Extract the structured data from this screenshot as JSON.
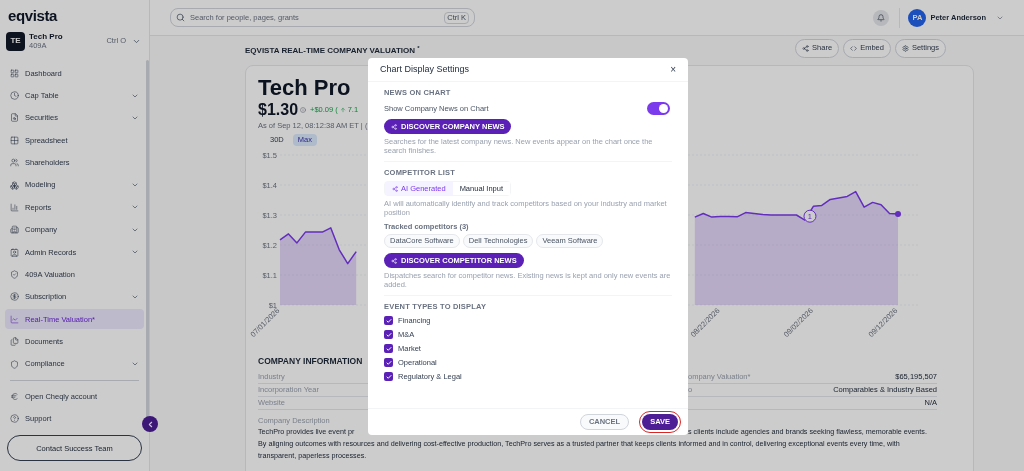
{
  "sidebar": {
    "logo": "eqvista",
    "workspace": {
      "initials": "TE",
      "name": "Tech Pro",
      "subtitle": "409A",
      "shortcut": "Ctrl O"
    },
    "items": [
      {
        "label": "Dashboard",
        "expandable": false,
        "selected": false
      },
      {
        "label": "Cap Table",
        "expandable": true,
        "selected": false
      },
      {
        "label": "Securities",
        "expandable": true,
        "selected": false
      },
      {
        "label": "Spreadsheet",
        "expandable": false,
        "selected": false
      },
      {
        "label": "Shareholders",
        "expandable": false,
        "selected": false
      },
      {
        "label": "Modeling",
        "expandable": true,
        "selected": false
      },
      {
        "label": "Reports",
        "expandable": true,
        "selected": false
      },
      {
        "label": "Company",
        "expandable": true,
        "selected": false
      },
      {
        "label": "Admin Records",
        "expandable": true,
        "selected": false
      },
      {
        "label": "409A Valuation",
        "expandable": false,
        "selected": false
      },
      {
        "label": "Subscription",
        "expandable": true,
        "selected": false
      },
      {
        "label": "Real-Time Valuation*",
        "expandable": false,
        "selected": true
      },
      {
        "label": "Documents",
        "expandable": false,
        "selected": false
      },
      {
        "label": "Compliance",
        "expandable": true,
        "selected": false
      }
    ],
    "footer_items": [
      {
        "label": "Open Cheqly account"
      },
      {
        "label": "Support"
      }
    ],
    "contact_button": "Contact Success Team"
  },
  "header": {
    "search": {
      "placeholder": "Search for people, pages, grants",
      "shortcut": "Ctrl K"
    },
    "user": {
      "initials": "PA",
      "name": "Peter Anderson"
    }
  },
  "page": {
    "title": "EQVISTA REAL-TIME COMPANY VALUATION $^{*}$",
    "actions": [
      "Share",
      "Embed",
      "Settings"
    ]
  },
  "valuation_card": {
    "company": "Tech Pro",
    "price": "$1.30",
    "change": "+$0.09",
    "change_open": "(",
    "change_pct": "7.1",
    "as_of": "As of Sep 12, 08:12:38 AM ET | (",
    "ranges": [
      {
        "label": "30D",
        "selected": false
      },
      {
        "label": "Max",
        "selected": true
      }
    ],
    "chart_data": {
      "type": "area",
      "ylim": [
        1,
        1.5
      ],
      "categories": [
        "07/01/2026",
        null,
        null,
        null,
        null,
        null,
        null,
        null,
        null,
        null,
        null,
        null,
        null,
        null,
        null,
        null,
        null,
        null,
        null,
        null,
        null,
        null,
        null,
        null,
        null,
        null,
        null,
        null,
        null,
        null,
        null,
        null,
        null,
        null,
        null,
        null,
        null,
        null,
        null,
        null,
        null,
        null,
        null,
        null,
        null,
        null,
        null,
        null,
        null,
        null,
        null,
        null,
        "08/22/2026",
        null,
        null,
        null,
        null,
        null,
        null,
        null,
        null,
        null,
        null,
        "09/02/2026",
        null,
        null,
        null,
        null,
        null,
        null,
        null,
        null,
        null,
        "09/12/2026"
      ],
      "series": [
        {
          "color": "#7c3aed",
          "values": [
            1.217,
            1.237,
            1.207,
            1.243,
            1.243,
            1.243,
            1.257,
            1.184,
            1.138,
            1.178,
            null,
            null,
            null,
            null,
            null,
            null,
            null,
            null,
            null,
            null,
            null,
            null,
            null,
            null,
            null,
            null,
            null,
            null,
            null,
            null,
            null,
            null,
            null,
            null,
            null,
            null,
            null,
            null,
            null,
            null,
            null,
            null,
            null,
            null,
            null,
            null,
            null,
            null,
            null,
            1.293,
            1.305,
            1.293,
            1.295,
            1.295,
            1.294,
            1.308,
            1.305,
            1.302,
            1.3,
            1.3,
            1.3,
            1.3,
            1.283,
            1.329,
            1.332,
            1.352,
            1.357,
            1.362,
            1.378,
            1.326,
            1.342,
            1.334,
            1.305,
            1.303
          ]
        }
      ],
      "yticks": [
        {
          "value": 1,
          "label": "$1"
        },
        {
          "value": 1.1,
          "label": "$1.1"
        },
        {
          "value": 1.2,
          "label": "$1.2"
        },
        {
          "value": 1.3,
          "label": "$1.3"
        },
        {
          "value": 1.4,
          "label": "$1.4"
        },
        {
          "value": 1.5,
          "label": "$1.5"
        }
      ],
      "grid": true,
      "annotations": [
        {
          "y": 1.296,
          "text": "1"
        }
      ]
    }
  },
  "company_information": {
    "title": "COMPANY INFORMATION",
    "left_rows": [
      {
        "label": "Industry"
      },
      {
        "label": "Incorporation Year"
      },
      {
        "label": "Website"
      }
    ],
    "right_rows": [
      {
        "label": "ompany Valuation*",
        "value": "$65,195,507"
      },
      {
        "label": "o",
        "value": "Comparables & Industry Based"
      },
      {
        "value": "N/A"
      }
    ],
    "description_label": "Company Description",
    "description_first_line": {
      "left": "TechPro provides live event pr",
      "right": "s clients include agencies and brands seeking flawless, memorable events."
    },
    "description_lines": [
      "By aligning outcomes with resources and delivering cost-effective production, TechPro serves as a trusted partner that keeps clients informed and in control, delivering exceptional events every time, with",
      "transparent, paperless processes."
    ]
  },
  "modal": {
    "title": "Chart Display Settings",
    "close": "×",
    "news_heading": "NEWS ON CHART",
    "news_toggle": {
      "label": "Show Company News on Chart",
      "on": true
    },
    "discover_company_button": "DISCOVER COMPANY NEWS",
    "company_help": "Searches for the latest company news. New events appear on the chart once the search finishes.",
    "competitor_heading": "COMPETITOR LIST",
    "competitor_modes": [
      {
        "label": "AI Generated",
        "selected": true
      },
      {
        "label": "Manual Input",
        "selected": false
      }
    ],
    "competitor_help": "AI will automatically identify and track competitors based on your industry and market position",
    "tracked_label": "Tracked competitors (3)",
    "competitors": [
      "DataCore Software",
      "Dell Technologies",
      "Veeam Software"
    ],
    "discover_competitor_button": "DISCOVER COMPETITOR NEWS",
    "competitor_news_help": "Dispatches search for competitor news. Existing news is kept and only new events are added.",
    "event_heading": "EVENT TYPES TO DISPLAY",
    "event_types": [
      {
        "label": "Financing",
        "checked": true
      },
      {
        "label": "M&A",
        "checked": true
      },
      {
        "label": "Market",
        "checked": true
      },
      {
        "label": "Operational",
        "checked": true
      },
      {
        "label": "Regulatory & Legal",
        "checked": true
      }
    ],
    "cancel": "CANCEL",
    "save": {
      "label": "SAVE",
      "highlighted": true
    }
  }
}
